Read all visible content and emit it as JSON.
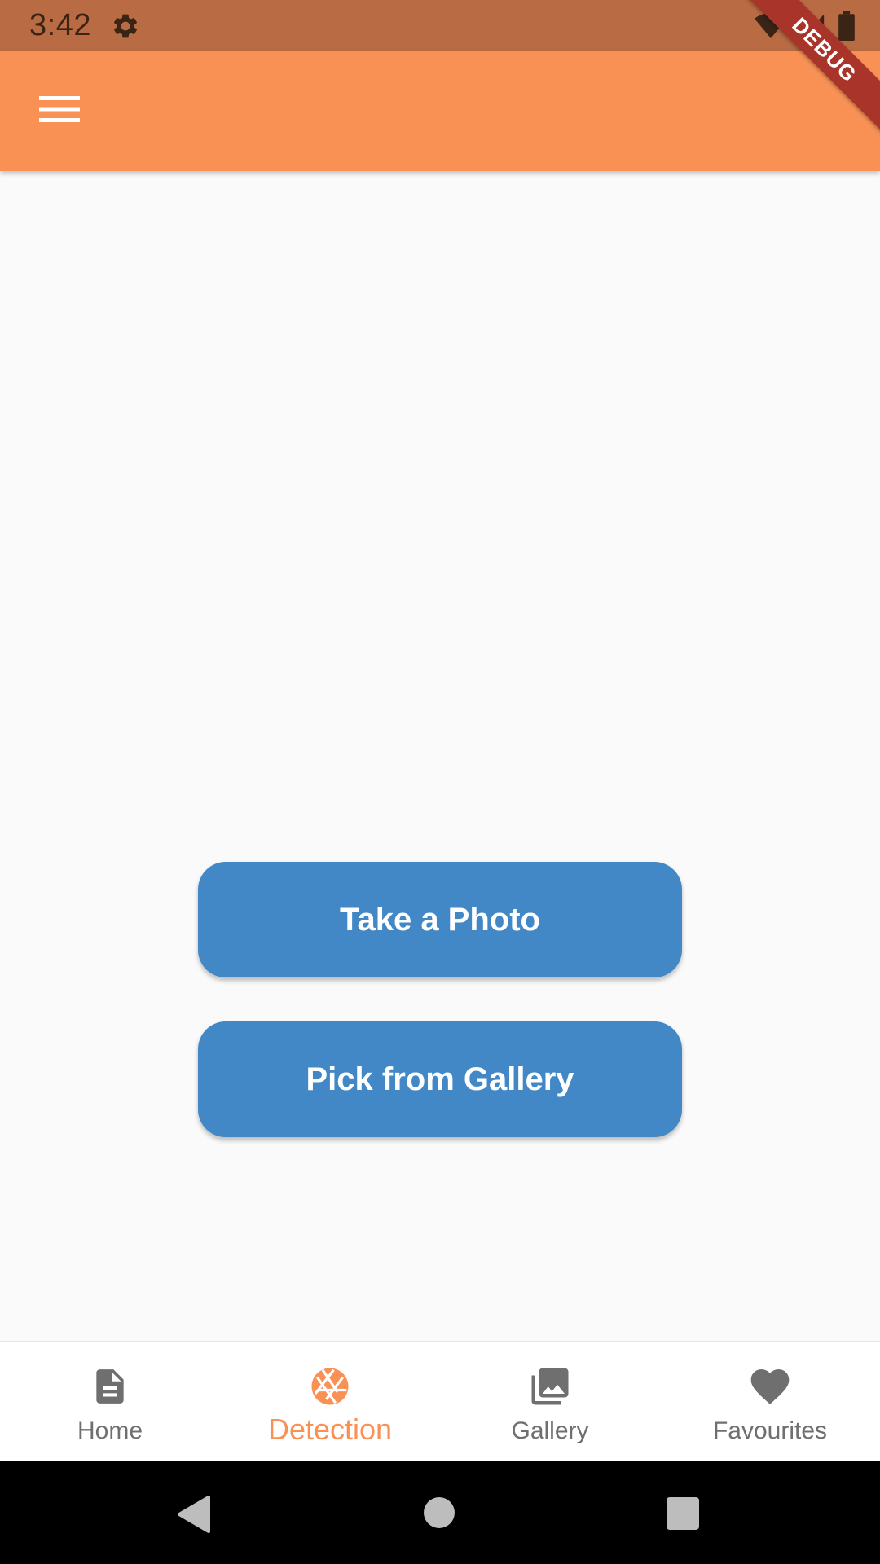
{
  "status_bar": {
    "time": "3:42"
  },
  "debug_banner": "DEBUG",
  "main": {
    "take_photo_label": "Take a Photo",
    "pick_gallery_label": "Pick from Gallery"
  },
  "bottom_nav": {
    "items": [
      {
        "label": "Home",
        "icon": "document-icon"
      },
      {
        "label": "Detection",
        "icon": "camera-aperture-icon",
        "active": true
      },
      {
        "label": "Gallery",
        "icon": "photo-library-icon"
      },
      {
        "label": "Favourites",
        "icon": "heart-icon"
      }
    ]
  },
  "colors": {
    "status_bar": "#b96b43",
    "app_bar": "#f99155",
    "accent": "#f99155",
    "button": "#4288c7",
    "nav_inactive": "#6f6f6f"
  }
}
